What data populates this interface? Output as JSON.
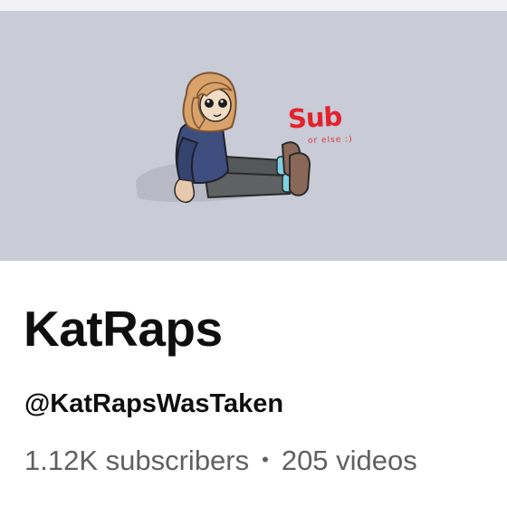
{
  "banner": {
    "art_text": "Sub",
    "art_subtext": "or else :)",
    "background_color": "#c9cbd6",
    "accent_color": "#e2232e"
  },
  "channel": {
    "name": "KatRaps",
    "handle": "@KatRapsWasTaken",
    "subscribers": "1.12K subscribers",
    "separator": "•",
    "videos": "205 videos"
  }
}
